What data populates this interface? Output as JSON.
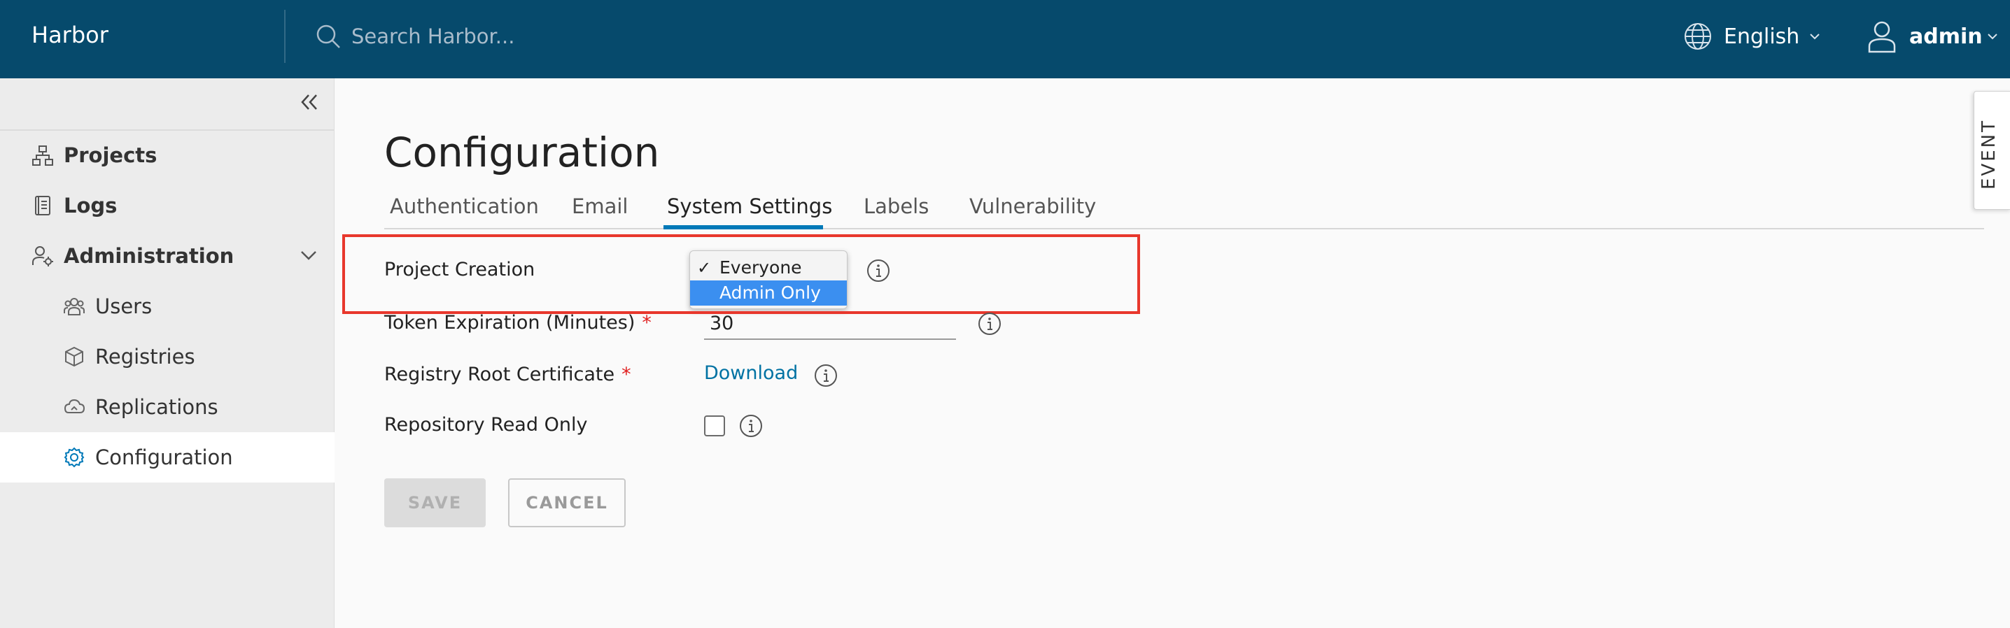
{
  "header": {
    "brand": "Harbor",
    "search_placeholder": "Search Harbor...",
    "language": "English",
    "user": "admin"
  },
  "sidebar": {
    "items": [
      {
        "label": "Projects",
        "icon": "projects-icon"
      },
      {
        "label": "Logs",
        "icon": "logs-icon"
      },
      {
        "label": "Administration",
        "icon": "administration-icon"
      },
      {
        "label": "Users",
        "icon": "users-icon"
      },
      {
        "label": "Registries",
        "icon": "registries-icon"
      },
      {
        "label": "Replications",
        "icon": "replications-icon"
      },
      {
        "label": "Configuration",
        "icon": "gear-icon",
        "active": true
      }
    ]
  },
  "main": {
    "title": "Configuration",
    "tabs": [
      {
        "label": "Authentication"
      },
      {
        "label": "Email"
      },
      {
        "label": "System Settings",
        "active": true
      },
      {
        "label": "Labels"
      },
      {
        "label": "Vulnerability"
      }
    ],
    "settings": {
      "project_creation_label": "Project Creation",
      "project_creation_options": [
        "Everyone",
        "Admin Only"
      ],
      "project_creation_checked": "Everyone",
      "project_creation_highlighted": "Admin Only",
      "token_label": "Token Expiration (Minutes)",
      "token_value": "30",
      "cert_label": "Registry Root Certificate",
      "cert_link": "Download",
      "readonly_label": "Repository Read Only",
      "required_mark": "*"
    },
    "buttons": {
      "save": "SAVE",
      "cancel": "CANCEL"
    }
  },
  "event_tab": "EVENT",
  "colors": {
    "header_bg": "#064a6c",
    "accent": "#0079b8",
    "link": "#0072a3",
    "highlight_border": "#e8372c",
    "selected_option": "#3b8ff0"
  }
}
